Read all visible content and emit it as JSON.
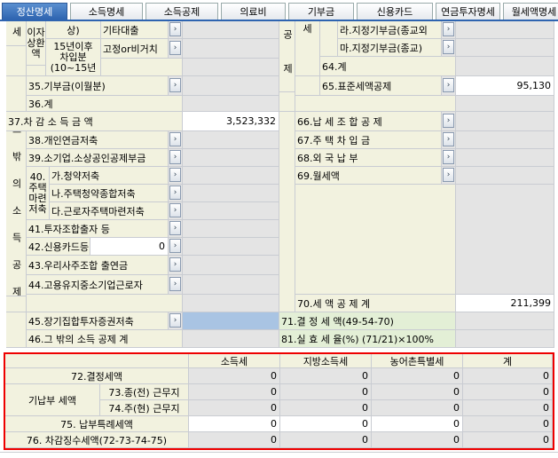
{
  "tabs": [
    "정산명세",
    "소득명세",
    "소득공제",
    "의료비",
    "기부금",
    "신용카드",
    "연금투자명세",
    "월세액명세"
  ],
  "left": {
    "row_a_l1": "이자",
    "row_a_l2": "상환",
    "row_a_l3": "액",
    "sang": "상)",
    "r15_l1": "15년이후",
    "r15_l2": "차입분",
    "r15_l3": "(10~15년",
    "gita": "기타대출",
    "goj": "고정or비거치",
    "r35": "35.기부금(이월분)",
    "r36": "36.계",
    "r37": "37.차 감 소 득 금 액",
    "r37_val": "3,523,332",
    "r38": "38.개인연금저축",
    "r39": "39.소기업.소상공인공제부금",
    "r40_l1": "40.",
    "r40_l2": "주택",
    "r40_l3": "마련",
    "r40_l4": "저축",
    "r40a": "가.청약저축",
    "r40b": "나.주택청약종합저축",
    "r40c": "다.근로자주택마련저축",
    "r41": "41.투자조합출자 등",
    "r42": "42.신용카드등",
    "r42_val": "0",
    "r43": "43.우리사주조합 출연금",
    "r44": "44.고용유지중소기업근로자",
    "r45": "45.장기집합투자증권저축",
    "r46": "46.그 밖의 소득 공제 계",
    "side_other": "그 밖 의 소 득 공 제",
    "side_top": "세"
  },
  "right": {
    "side_top": "공 제",
    "side_top2": "세",
    "ra": "라.지정기부금(종교외",
    "rb": "마.지정기부금(종교)",
    "r64": "64.계",
    "r65": "65.표준세액공제",
    "r65_val": "95,130",
    "r66": "66.납 세 조 합 공 제",
    "r67": "67.주 택 차 입 금",
    "r68": "68.외   국   납   부",
    "r69": "69.월세액",
    "r70": "70.세 액 공 제 계",
    "r70_val": "211,399",
    "r71": "71.결  정  세  액(49-54-70)",
    "r81": "81.실 효 세 율(%) (71/21)×100%"
  },
  "summary": {
    "headers": [
      "소득세",
      "지방소득세",
      "농어촌특별세",
      "계"
    ],
    "r72": "72.결정세액",
    "gi": "기납부 세액",
    "r73": "73.종(전) 근무지",
    "r74": "74.주(현) 근무지",
    "r75": "75. 납부특례세액",
    "r76": "76. 차감징수세액(72-73-74-75)",
    "values": [
      [
        "0",
        "0",
        "0",
        "0"
      ],
      [
        "0",
        "0",
        "0",
        "0"
      ],
      [
        "0",
        "0",
        "0",
        "0"
      ],
      [
        "0",
        "0",
        "0",
        "0"
      ],
      [
        "0",
        "0",
        "0",
        "0"
      ]
    ]
  },
  "arrow": "›"
}
